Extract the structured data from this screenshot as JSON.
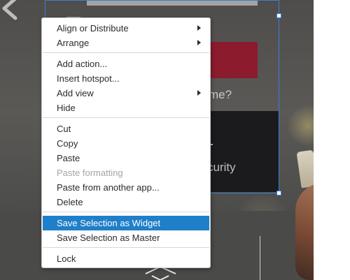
{
  "canvas": {
    "text_me": "me?",
    "text_security": "curity"
  },
  "context_menu": {
    "items": [
      {
        "label": "Align or Distribute",
        "submenu": true
      },
      {
        "label": "Arrange",
        "submenu": true
      },
      {
        "label": "Add action...",
        "submenu": false
      },
      {
        "label": "Insert hotspot...",
        "submenu": false
      },
      {
        "label": "Add view",
        "submenu": true
      },
      {
        "label": "Hide",
        "submenu": false
      },
      {
        "label": "Cut",
        "submenu": false
      },
      {
        "label": "Copy",
        "submenu": false
      },
      {
        "label": "Paste",
        "submenu": false
      },
      {
        "label": "Paste formatting",
        "submenu": false,
        "disabled": true
      },
      {
        "label": "Paste from another app...",
        "submenu": false
      },
      {
        "label": "Delete",
        "submenu": false
      },
      {
        "label": "Save Selection as Widget",
        "submenu": false,
        "highlighted": true
      },
      {
        "label": "Save Selection as Master",
        "submenu": false
      },
      {
        "label": "Lock",
        "submenu": false
      }
    ]
  },
  "colors": {
    "highlight": "#1f7fc8",
    "selection_frame": "#3b7fd0",
    "accent_red": "#8c1b2d"
  }
}
